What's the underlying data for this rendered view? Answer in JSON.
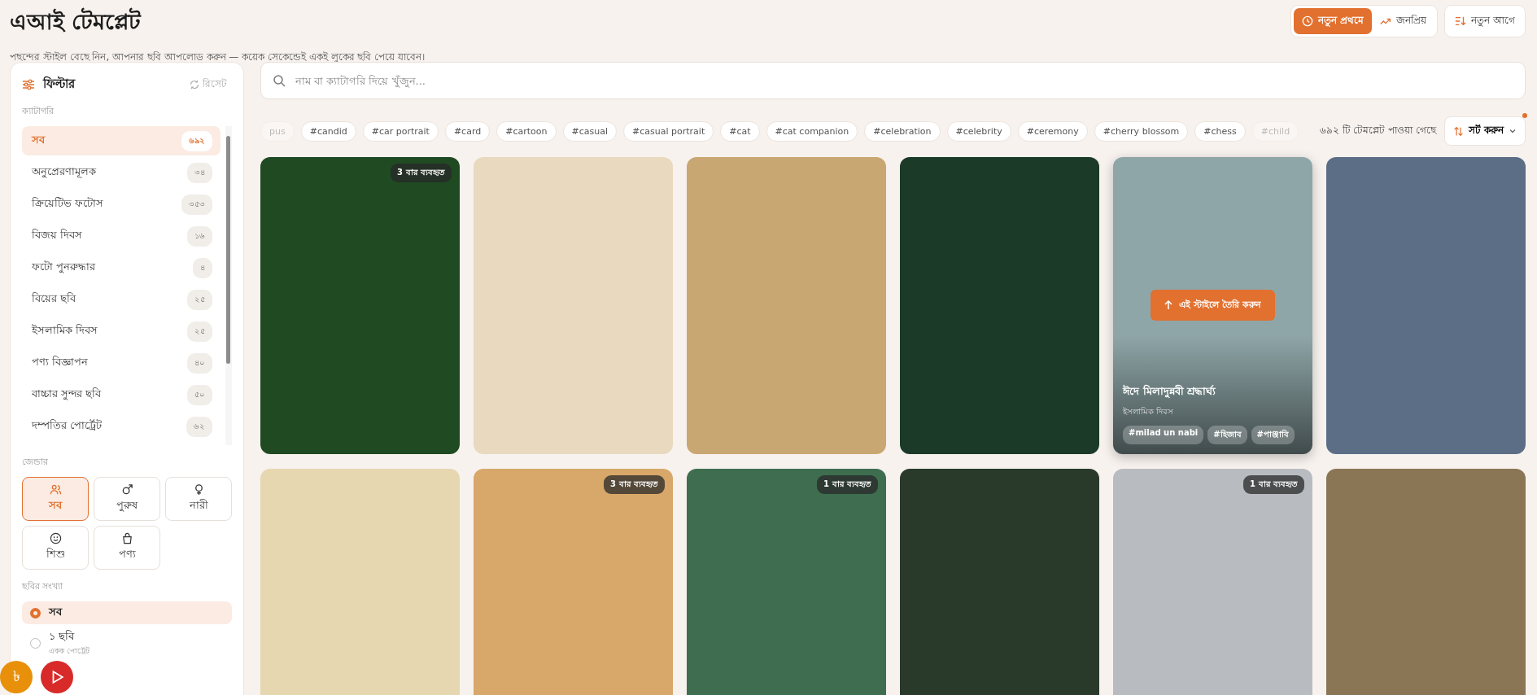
{
  "header": {
    "title": "এআই টেমপ্লেট",
    "subtitle": "পছন্দের স্টাইল বেছে নিন, আপনার ছবি আপলোড করুন — কয়েক সেকেন্ডেই একই লুকের ছবি পেয়ে যাবেন।"
  },
  "sort_tabs": [
    {
      "label": "নতুন প্রথমে",
      "selected": true
    },
    {
      "label": "জনপ্রিয়",
      "selected": false
    }
  ],
  "order_button": {
    "label": "নতুন আগে"
  },
  "filter": {
    "title": "ফিল্টার",
    "reset": "রিসেট",
    "category_label": "ক্যাটাগরি",
    "categories": [
      {
        "label": "সব",
        "count": "৬৯২",
        "selected": true
      },
      {
        "label": "অনুপ্রেরণামূলক",
        "count": "৩৪",
        "selected": false
      },
      {
        "label": "ক্রিয়েটিভ ফটোস",
        "count": "৩৫৩",
        "selected": false
      },
      {
        "label": "বিজয় দিবস",
        "count": "১৬",
        "selected": false
      },
      {
        "label": "ফটো পুনরুদ্ধার",
        "count": "৪",
        "selected": false
      },
      {
        "label": "বিয়ের ছবি",
        "count": "২৫",
        "selected": false
      },
      {
        "label": "ইসলামিক দিবস",
        "count": "২৫",
        "selected": false
      },
      {
        "label": "পণ্য বিজ্ঞাপন",
        "count": "৪০",
        "selected": false
      },
      {
        "label": "বাচ্চার সুন্দর ছবি",
        "count": "৫০",
        "selected": false
      },
      {
        "label": "দম্পতির পোর্ট্রেট",
        "count": "৬২",
        "selected": false
      }
    ],
    "gender_label": "জেন্ডার",
    "genders": [
      {
        "label": "সব",
        "selected": true
      },
      {
        "label": "পুরুষ",
        "selected": false
      },
      {
        "label": "নারী",
        "selected": false
      },
      {
        "label": "শিশু",
        "selected": false
      },
      {
        "label": "পণ্য",
        "selected": false
      }
    ],
    "count_label": "ছবির সংখ্যা",
    "counts": [
      {
        "label": "সব",
        "selected": true
      },
      {
        "label": "১ ছবি",
        "sublabel": "একক পোর্ট্রেট",
        "selected": false
      }
    ]
  },
  "search": {
    "placeholder": "নাম বা ক্যাটাগরি দিয়ে খুঁজুন..."
  },
  "tags": [
    {
      "label": "pus",
      "faded": true
    },
    {
      "label": "#candid",
      "faded": false
    },
    {
      "label": "#car portrait",
      "faded": false
    },
    {
      "label": "#card",
      "faded": false
    },
    {
      "label": "#cartoon",
      "faded": false
    },
    {
      "label": "#casual",
      "faded": false
    },
    {
      "label": "#casual portrait",
      "faded": false
    },
    {
      "label": "#cat",
      "faded": false
    },
    {
      "label": "#cat companion",
      "faded": false
    },
    {
      "label": "#celebration",
      "faded": false
    },
    {
      "label": "#celebrity",
      "faded": false
    },
    {
      "label": "#ceremony",
      "faded": false
    },
    {
      "label": "#cherry blossom",
      "faded": false
    },
    {
      "label": "#chess",
      "faded": false
    },
    {
      "label": "#child",
      "faded": true
    }
  ],
  "result_count": "৬৯২ টি টেমপ্লেট পাওয়া গেছে",
  "sort_button": {
    "label": "সর্ট করুন"
  },
  "templates": [
    {
      "hovered": false,
      "badge": "3 বার ব্যবহৃত"
    },
    {
      "hovered": false
    },
    {
      "hovered": false
    },
    {
      "hovered": false
    },
    {
      "hovered": true,
      "action": "এই স্টাইলে তৈরি করুন",
      "title": "ঈদে মিলাদুন্নবী শ্রদ্ধার্ঘ্য",
      "category": "ইসলামিক দিবস",
      "tags": [
        "#milad un nabi",
        "#হিজাব",
        "#পাঞ্জাবি"
      ]
    },
    {
      "hovered": false
    },
    {
      "hovered": false
    },
    {
      "hovered": false,
      "badge": "3 বার ব্যবহৃত"
    },
    {
      "hovered": false,
      "badge": "1 বার ব্যবহৃত"
    },
    {
      "hovered": false
    },
    {
      "hovered": false,
      "badge": "1 বার ব্যবহৃত"
    },
    {
      "hovered": false
    }
  ],
  "currency_button": {
    "symbol": "৳"
  }
}
